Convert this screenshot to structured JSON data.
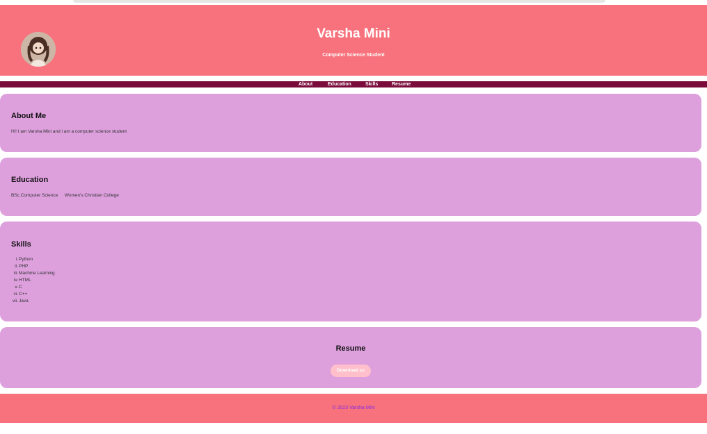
{
  "colors": {
    "header_bg": "#f7727c",
    "nav_bg": "#7a0b3a",
    "card_bg": "#dda0dd",
    "button_bg": "#ffc0cb",
    "footer_text": "#8a2be2"
  },
  "header": {
    "avatar_icon": "profile-photo",
    "name": "Varsha Mini",
    "subtitle": "Computer Science Student"
  },
  "nav": {
    "items": [
      {
        "label": "About"
      },
      {
        "label": "Education"
      },
      {
        "label": "Skills"
      },
      {
        "label": "Resume"
      }
    ]
  },
  "about": {
    "title": "About Me",
    "text": "Hi! I am Varsha Mini and i am a computer science student"
  },
  "education": {
    "title": "Education",
    "degree": "BSc.Computer Science",
    "college": "Women's Christian College"
  },
  "skills": {
    "title": "Skills",
    "items": [
      {
        "num": "i.",
        "label": "Python"
      },
      {
        "num": "ii.",
        "label": "PHP"
      },
      {
        "num": "iii.",
        "label": "Machine Learning"
      },
      {
        "num": "iv.",
        "label": "HTML"
      },
      {
        "num": "v.",
        "label": "C"
      },
      {
        "num": "vi.",
        "label": "C++"
      },
      {
        "num": "vii.",
        "label": "Java"
      }
    ]
  },
  "resume": {
    "title": "Resume",
    "button_label": "Download cv"
  },
  "footer": {
    "copyright": "© 2023 Varsha Mini"
  }
}
